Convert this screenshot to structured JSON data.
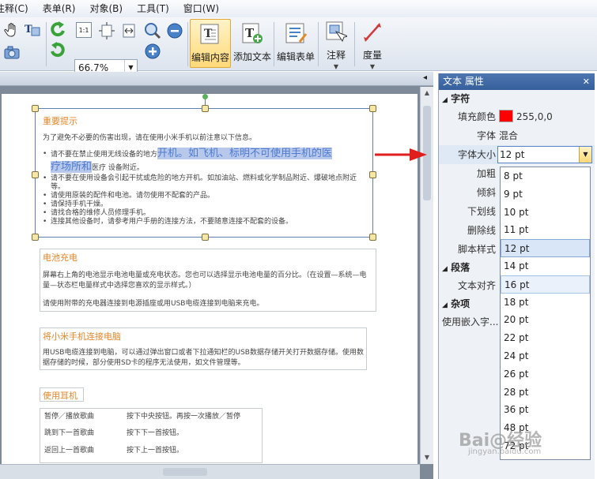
{
  "menubar": {
    "items": [
      "注释(C)",
      "表单(R)",
      "对象(B)",
      "工具(T)",
      "窗口(W)"
    ]
  },
  "toolbar": {
    "zoom_value": "66.7%",
    "edit_content_label": "编辑内容",
    "add_text_label": "添加文本",
    "edit_form_label": "编辑表单",
    "annotate_label": "注释",
    "measure_label": "度量"
  },
  "document": {
    "block1_title": "重要提示",
    "block1_intro": "为了避免不必要的伤害出现，请在使用小米手机以前注意以下信息。",
    "bullet1_pre": "请不要在禁止使用无线设备的地方",
    "bullet1_big1": "开机。如飞机、标明不可使用手机的医",
    "bullet1_big2": "疗场所和",
    "bullet1_post": "医疗 设备附近。",
    "bullets": [
      "请不要在使用设备会引起干扰或危险的地方开机。如加油站、燃料或化学制品附近、爆破地点附近等。",
      "请使用原装的配件和电池。请勿使用不配套的产品。",
      "请保持手机干燥。",
      "请找合格的维修人员修理手机。",
      "连接其他设备时，请参考用户手册的连接方法，不要随意连接不配套的设备。"
    ],
    "block2_title": "电池充电",
    "block2_p1": "屏幕右上角的电池显示电池电量或充电状态。您也可以选择显示电池电量的百分比。（在设置—系统—电量—状态栏电量样式中选择您喜欢的显示样式。）",
    "block2_p2": "请使用附带的充电器连接到电源插座或用USB电缆连接到电脑来充电。",
    "block3_title": "将小米手机连接电脑",
    "block3_p": "用USB电缆连接到电脑，可以通过弹出窗口或者下拉通知栏的USB数据存储开关打开数据存储。使用数据存储的时候，部分使用SD卡的程序无法使用，如文件管理等。",
    "block4_title": "使用耳机",
    "table": [
      [
        "暂停／播放歌曲",
        "按下中央按钮。再按一次播放／暂停"
      ],
      [
        "跳到下一首歌曲",
        "按下下一首按钮。"
      ],
      [
        "返回上一首歌曲",
        "按下上一首按钮。"
      ]
    ]
  },
  "panel": {
    "title": "文本 属性",
    "section_char": "字符",
    "fill_color_label": "填充颜色",
    "fill_color_value": "255,0,0",
    "fill_color_hex": "#ff0000",
    "font_label": "字体",
    "font_value": "混合",
    "font_size_label": "字体大小",
    "font_size_value": "12 pt",
    "bold_label": "加粗",
    "italic_label": "倾斜",
    "underline_label": "下划线",
    "strike_label": "删除线",
    "script_label": "脚本样式",
    "section_para": "段落",
    "align_label": "文本对齐",
    "section_misc": "杂项",
    "embed_label": "使用嵌入字..."
  },
  "font_size_options": [
    "8 pt",
    "9 pt",
    "10 pt",
    "11 pt",
    "12 pt",
    "14 pt",
    "16 pt",
    "18 pt",
    "20 pt",
    "22 pt",
    "24 pt",
    "26 pt",
    "28 pt",
    "36 pt",
    "48 pt",
    "72 pt"
  ],
  "font_size_selected": "12 pt",
  "watermark": {
    "text": "Bai@经验",
    "url": "jingyan.baidu.com"
  }
}
